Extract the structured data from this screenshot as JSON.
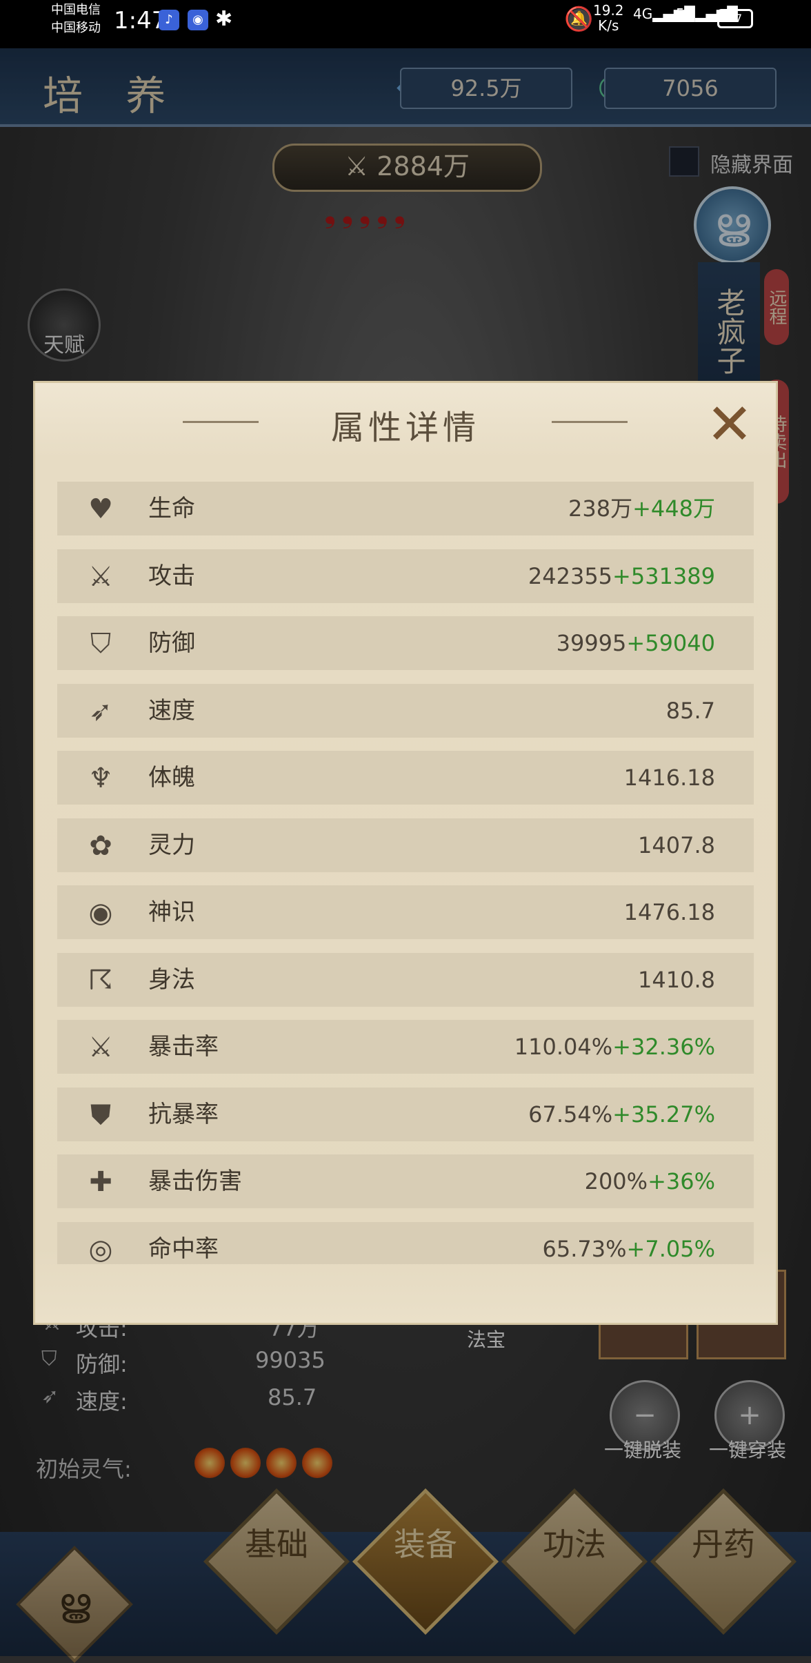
{
  "status_bar": {
    "carrier1": "中国电信",
    "carrier2": "中国移动",
    "time": "1:47",
    "net_speed": "19.2",
    "net_unit": "K/s",
    "net1": "4G",
    "net2": "5G",
    "battery": "57"
  },
  "header": {
    "title": "培 养",
    "currency1": "92.5万",
    "currency2": "7056",
    "power": "2884万",
    "hide_ui": "隐藏界面",
    "talent": "天赋",
    "side_name": "老疯子",
    "tag1": "远程",
    "tag2": "侍卖出"
  },
  "dialog": {
    "title": "属性详情",
    "rows": [
      {
        "icon": "heart-icon",
        "label": "生命",
        "base": "238万",
        "bonus": "+448万"
      },
      {
        "icon": "sword-icon",
        "label": "攻击",
        "base": "242355",
        "bonus": "+531389"
      },
      {
        "icon": "shield-icon",
        "label": "防御",
        "base": "39995",
        "bonus": "+59040"
      },
      {
        "icon": "speed-icon",
        "label": "速度",
        "base": "85.7",
        "bonus": ""
      },
      {
        "icon": "strength-icon",
        "label": "体魄",
        "base": "1416.18",
        "bonus": ""
      },
      {
        "icon": "spirit-flower-icon",
        "label": "灵力",
        "base": "1407.8",
        "bonus": ""
      },
      {
        "icon": "eye-icon",
        "label": "神识",
        "base": "1476.18",
        "bonus": ""
      },
      {
        "icon": "running-figure-icon",
        "label": "身法",
        "base": "1410.8",
        "bonus": ""
      },
      {
        "icon": "crit-sword-icon",
        "label": "暴击率",
        "base": "110.04%",
        "bonus": "+32.36%"
      },
      {
        "icon": "anti-crit-shield-icon",
        "label": "抗暴率",
        "base": "67.54%",
        "bonus": "+35.27%"
      },
      {
        "icon": "crit-damage-icon",
        "label": "暴击伤害",
        "base": "200%",
        "bonus": "+36%"
      },
      {
        "icon": "target-icon",
        "label": "命中率",
        "base": "65.73%",
        "bonus": "+7.05%"
      }
    ]
  },
  "background_stats": {
    "attack_label": "攻击:",
    "attack_value": "77万",
    "defense_label": "防御:",
    "defense_value": "99035",
    "speed_label": "速度:",
    "speed_value": "85.7",
    "initial_aura": "初始灵气:",
    "fabao": "法宝",
    "unequip_all": "一键脱装",
    "equip_all": "一键穿装"
  },
  "bottom_nav": {
    "basic": "基础",
    "equipment": "装备",
    "technique": "功法",
    "elixir": "丹药"
  }
}
